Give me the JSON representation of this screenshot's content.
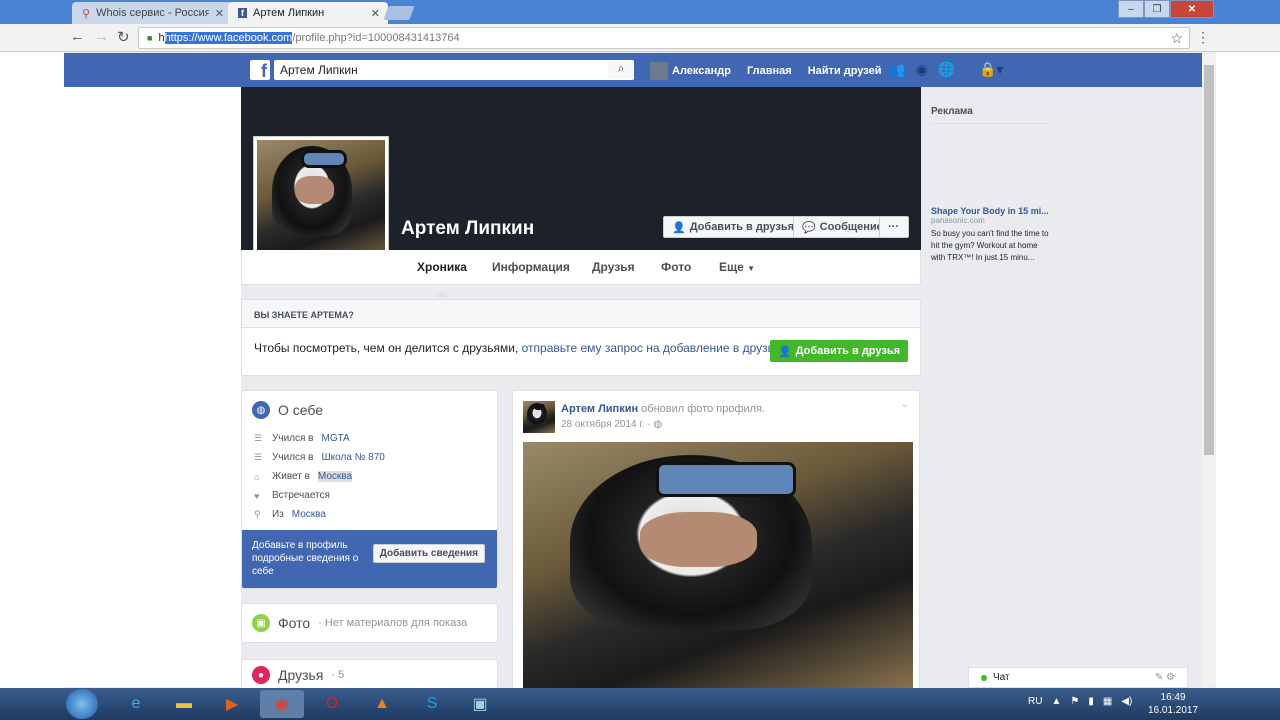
{
  "browser": {
    "tabs": [
      {
        "title": "Whois сервис - Россия"
      },
      {
        "title": "Артем Липкин"
      }
    ],
    "url_selected": "https://www.facebook.com",
    "url_rest": "/profile.php?id=100008431413764",
    "url_prefix": "h"
  },
  "fb": {
    "search_value": "Артем Липкин",
    "user_name": "Александр",
    "nav_home": "Главная",
    "nav_find_friends": "Найти друзей"
  },
  "profile": {
    "name": "Артем Липкин",
    "add_friend": "Добавить в друзья",
    "message": "Сообщение",
    "more_dots": "···",
    "tabs": [
      "Хроника",
      "Информация",
      "Друзья",
      "Фото",
      "Еще"
    ]
  },
  "know": {
    "heading": "ВЫ ЗНАЕТЕ АРТЕМА?",
    "text": "Чтобы посмотреть, чем он делится с друзьями,",
    "link": "отправьте ему запрос на добавление в друзья.",
    "button": "Добавить в друзья"
  },
  "about": {
    "title": "О себе",
    "rows": [
      {
        "pre": "Учился в",
        "link": "MGTA"
      },
      {
        "pre": "Учился в",
        "link": "Школа № 870"
      },
      {
        "pre": "Живет в",
        "link": "Москва"
      },
      {
        "pre": "Встречается",
        "link": ""
      },
      {
        "pre": "Из",
        "link": "Москва"
      }
    ],
    "cta_text": "Добавьте в профиль подробные сведения о себе",
    "cta_button": "Добавить сведения"
  },
  "photos": {
    "title": "Фото",
    "sub": "· Нет материалов для показа"
  },
  "friends": {
    "title": "Друзья",
    "count": "· 5"
  },
  "post": {
    "author": "Артем Липкин",
    "action": "обновил фото профиля.",
    "date": "28 октября 2014 г. ·"
  },
  "ads": {
    "heading": "Реклама",
    "title": "Shape Your Body in 15 mi...",
    "domain": "panasonic.com",
    "body": "So busy you can't find the time to hit the gym? Workout at home with TRX™! In just 15 minu..."
  },
  "chat": {
    "label": "Чат"
  },
  "taskbar": {
    "lang": "RU",
    "time": "16:49",
    "date": "16.01.2017"
  },
  "colors": {
    "fb_blue": "#4267b2",
    "green": "#42b72a",
    "link": "#365899"
  }
}
